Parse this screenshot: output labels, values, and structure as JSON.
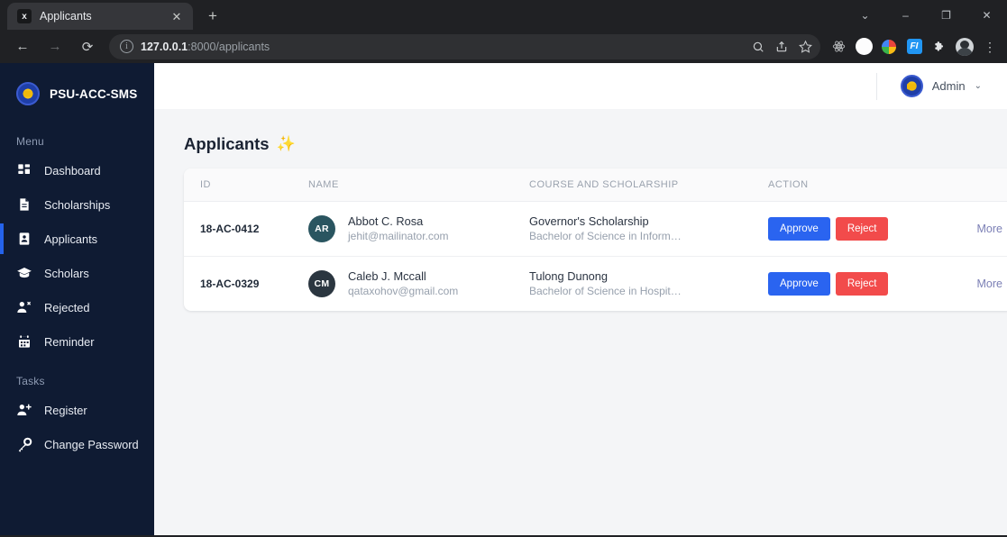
{
  "browser": {
    "tab": {
      "title": "Applicants",
      "favicon_letter": "x",
      "close_label": "✕"
    },
    "new_tab_label": "+",
    "window_controls": {
      "collapse": "⌄",
      "minimize": "–",
      "maximize": "❐",
      "close": "✕"
    },
    "nav": {
      "back": "←",
      "forward": "→",
      "reload": "⟳"
    },
    "omnibox": {
      "info_icon": "i",
      "url_host": "127.0.0.1",
      "url_rest": ":8000/applicants",
      "search_icon": "search-icon",
      "share_icon": "share-icon",
      "bookmark_icon": "star-icon"
    },
    "extensions": [
      "react-icon",
      "circle-icon",
      "color-wheel-icon",
      "FI",
      "puzzle-icon",
      "profile-avatar-icon"
    ],
    "menu_icon": "⋮"
  },
  "sidebar": {
    "brand": "PSU-ACC-SMS",
    "sections": [
      {
        "label": "Menu",
        "items": [
          {
            "label": "Dashboard",
            "icon": "grid-icon",
            "active": false
          },
          {
            "label": "Scholarships",
            "icon": "document-icon",
            "active": false
          },
          {
            "label": "Applicants",
            "icon": "id-card-icon",
            "active": true
          },
          {
            "label": "Scholars",
            "icon": "graduation-cap-icon",
            "active": false
          },
          {
            "label": "Rejected",
            "icon": "user-x-icon",
            "active": false
          },
          {
            "label": "Reminder",
            "icon": "calendar-icon",
            "active": false
          }
        ]
      },
      {
        "label": "Tasks",
        "items": [
          {
            "label": "Register",
            "icon": "user-plus-icon",
            "active": false
          },
          {
            "label": "Change Password",
            "icon": "key-icon",
            "active": false
          }
        ]
      }
    ]
  },
  "topbar": {
    "user_name": "Admin",
    "caret": "⌄"
  },
  "page": {
    "title": "Applicants",
    "title_emoji": "✨"
  },
  "table": {
    "headers": {
      "id": "ID",
      "name": "NAME",
      "course": "COURSE AND SCHOLARSHIP",
      "action": "ACTION"
    },
    "rows": [
      {
        "id": "18-AC-0412",
        "initials": "AR",
        "avatar_color": "#2a5560",
        "name": "Abbot C. Rosa",
        "email": "jehit@mailinator.com",
        "scholarship": "Governor's Scholarship",
        "course": "Bachelor of Science in Informati...",
        "approve_label": "Approve",
        "reject_label": "Reject",
        "more_label": "More"
      },
      {
        "id": "18-AC-0329",
        "initials": "CM",
        "avatar_color": "#2b3640",
        "name": "Caleb J. Mccall",
        "email": "qataxohov@gmail.com",
        "scholarship": "Tulong Dunong",
        "course": "Bachelor of Science in Hospitali...",
        "approve_label": "Approve",
        "reject_label": "Reject",
        "more_label": "More"
      }
    ]
  },
  "colors": {
    "sidebar_bg": "#0f1b33",
    "active_indicator": "#2563eb",
    "approve": "#2a64f0",
    "reject": "#f24b4b",
    "more_link": "#7b7fb5",
    "page_bg": "#f4f5f7"
  }
}
